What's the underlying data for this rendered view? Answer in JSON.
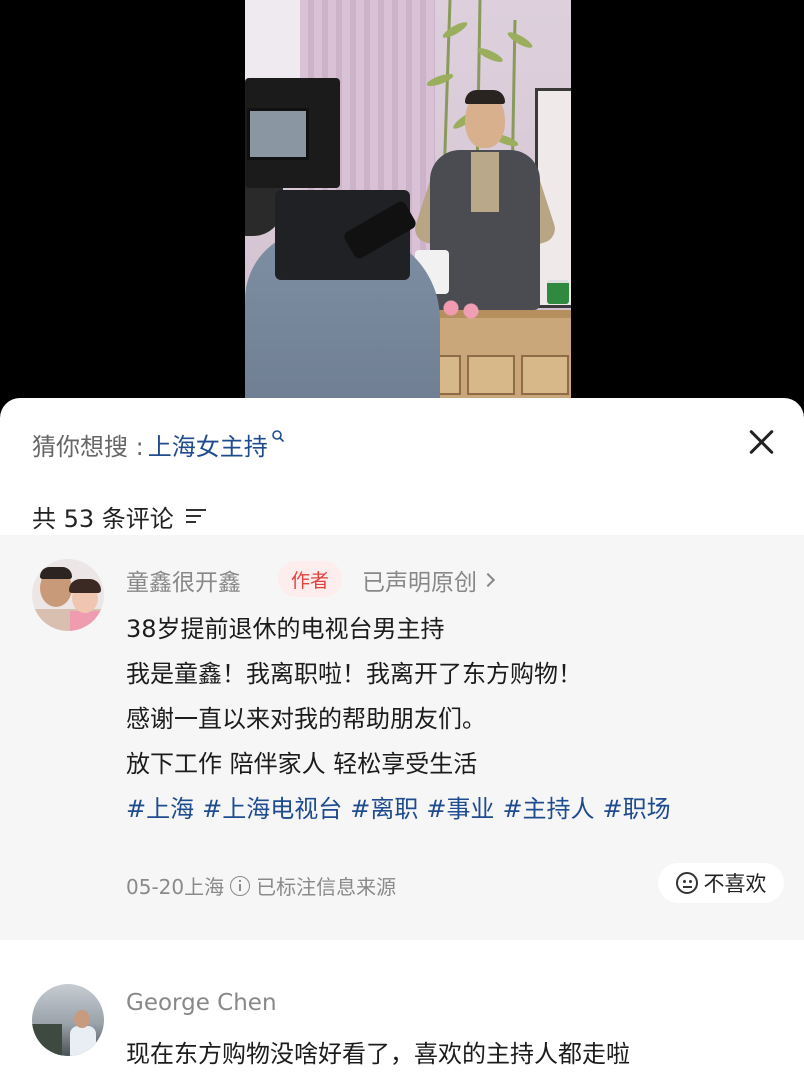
{
  "search_suggestion": {
    "prefix": "猜你想搜 :",
    "term": "上海女主持"
  },
  "comments_header": {
    "count_label": "共 53 条评论"
  },
  "pinned_comment": {
    "author": "童鑫很开鑫",
    "badge": "作者",
    "claim": "已声明原创",
    "lines": [
      "38岁提前退休的电视台男主持",
      "我是童鑫！我离职啦！我离开了东方购物！",
      "感谢一直以来对我的帮助朋友们。",
      "放下工作 陪伴家人 轻松享受生活"
    ],
    "tags": [
      "#上海",
      "#上海电视台",
      "#离职",
      "#事业",
      "#主持人",
      "#职场"
    ],
    "date_location": "05-20上海",
    "source_note": "已标注信息来源",
    "dislike_label": "不喜欢"
  },
  "comment_2": {
    "author": "George Chen",
    "text": "现在东方购物没啥好看了，喜欢的主持人都走啦"
  },
  "colors": {
    "link_blue": "#1f4c8f",
    "author_badge_red": "#e2423d",
    "pinned_bg": "#f6f6f6"
  },
  "icons": [
    "search-icon",
    "close-icon",
    "sort-icon",
    "chevron-right-icon",
    "info-icon",
    "dislike-face-icon"
  ]
}
